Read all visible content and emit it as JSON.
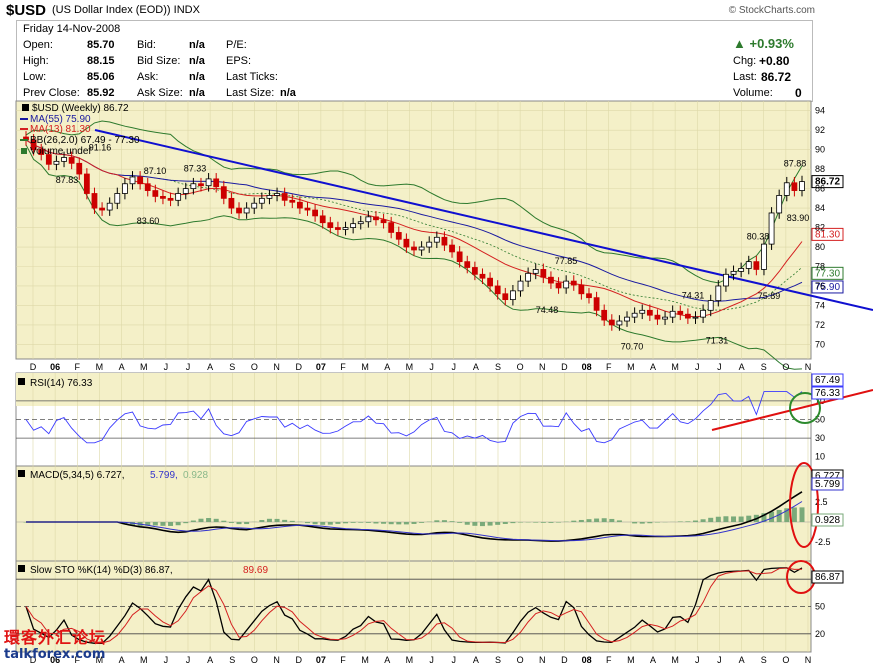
{
  "header": {
    "symbol": "$USD",
    "name": "(US Dollar Index (EOD))",
    "exchange": "INDX",
    "copyright": "© StockCharts.com"
  },
  "quote": {
    "date": "Friday  14-Nov-2008",
    "open_label": "Open:",
    "open": "85.70",
    "high_label": "High:",
    "high": "88.15",
    "low_label": "Low:",
    "low": "85.06",
    "prev_label": "Prev Close:",
    "prev": "85.92",
    "bid_label": "Bid:",
    "bid": "n/a",
    "bidsize_label": "Bid Size:",
    "bidsize": "n/a",
    "ask_label": "Ask:",
    "ask": "n/a",
    "asksize_label": "Ask Size:",
    "asksize": "n/a",
    "pe_label": "P/E:",
    "eps_label": "EPS:",
    "lastticks_label": "Last Ticks:",
    "lastsize_label": "Last Size:",
    "lastsize": "n/a",
    "pct_change": "+0.93%",
    "chg_label": "Chg:",
    "chg": "+0.80",
    "last_label": "Last:",
    "last": "86.72",
    "volume_label": "Volume:",
    "volume": "0"
  },
  "legend": {
    "main": "$USD (Weekly) 86.72",
    "ma55": "MA(55) 75.90",
    "ma13": "MA(13) 81.30",
    "bb": "BB(26,2.0) 67.49 - 77.30",
    "vol": "Volume undef",
    "rsi": "RSI(14) 76.33",
    "macd_a": "MACD(5,34,5) 6.727,",
    "macd_b": "5.799,",
    "macd_c": "0.928",
    "sto_a": "Slow STO %K(14) %D(3) 86.87,",
    "sto_b": "89.69"
  },
  "colors": {
    "panel_bg": "#f4f0c8",
    "rsi_bg": "#ffffff",
    "price_up": "#000000",
    "price_down": "#cc0000",
    "bb": "#2d7a2d",
    "ma55": "#1a1aa0",
    "ma13": "#d42020",
    "trend_main": "#1010d0",
    "annotation": "#e01010"
  },
  "watermark": {
    "line1": "環客外汇论坛",
    "line2": "talkforex.com"
  },
  "chart_data": [
    {
      "type": "candlestick",
      "title": "$USD (Weekly) 86.72",
      "x_ticks": [
        "D",
        "06",
        "F",
        "M",
        "A",
        "M",
        "J",
        "J",
        "A",
        "S",
        "O",
        "N",
        "D",
        "07",
        "F",
        "M",
        "A",
        "M",
        "J",
        "J",
        "A",
        "S",
        "O",
        "N",
        "D",
        "08",
        "F",
        "M",
        "A",
        "M",
        "J",
        "J",
        "A",
        "S",
        "O",
        "N"
      ],
      "y_ticks": [
        70,
        72,
        74,
        76,
        78,
        80,
        82,
        84,
        86,
        88,
        90,
        92,
        94
      ],
      "ylim": [
        68.5,
        95
      ],
      "close_series": [
        91,
        90,
        89.5,
        88.5,
        88.8,
        89.2,
        88.6,
        87.5,
        85.5,
        84,
        83.8,
        84.5,
        85.5,
        86.5,
        87.2,
        86.5,
        85.8,
        85.2,
        85,
        84.8,
        85.5,
        86,
        86.5,
        86.3,
        87,
        86.2,
        85,
        84,
        83.5,
        84,
        84.5,
        85,
        85.3,
        85.5,
        84.8,
        84.6,
        84,
        83.8,
        83.2,
        82.5,
        82,
        81.8,
        82,
        82.4,
        82.6,
        83.1,
        82.8,
        82.5,
        81.5,
        80.8,
        80,
        79.7,
        80,
        80.5,
        81,
        80.2,
        79.5,
        78.5,
        77.9,
        77.2,
        76.8,
        76,
        75.2,
        74.6,
        75.5,
        76.5,
        77.3,
        77.7,
        76.9,
        76.3,
        75.8,
        76.5,
        76.1,
        75.2,
        74.8,
        73.5,
        72.5,
        72,
        72.4,
        72.8,
        73.2,
        73.5,
        73,
        72.6,
        72.8,
        73.4,
        73.1,
        72.7,
        72.8,
        73.5,
        74.5,
        76,
        77.2,
        77.5,
        77.8,
        78.5,
        77.7,
        80.3,
        83.5,
        85.3,
        86.6,
        85.8,
        86.72
      ],
      "annotations": [
        {
          "label": "91.16",
          "value": 91.16
        },
        {
          "label": "87.83",
          "value": 87.83
        },
        {
          "label": "87.33",
          "value": 87.33
        },
        {
          "label": "83.60",
          "value": 83.6
        },
        {
          "label": "87.10",
          "value": 87.1
        },
        {
          "label": "77.85",
          "value": 77.85
        },
        {
          "label": "74.48",
          "value": 74.48
        },
        {
          "label": "74.31",
          "value": 74.31
        },
        {
          "label": "70.70",
          "value": 70.7
        },
        {
          "label": "71.31",
          "value": 71.31
        },
        {
          "label": "75.89",
          "value": 75.89
        },
        {
          "label": "80.38",
          "value": 80.38
        },
        {
          "label": "83.90",
          "value": 83.9
        },
        {
          "label": "87.88",
          "value": 87.88
        }
      ],
      "right_labels": [
        {
          "label": "86.72",
          "value": 86.72
        },
        {
          "label": "81.30",
          "value": 81.3
        },
        {
          "label": "77.30",
          "value": 77.3
        },
        {
          "label": "75.90",
          "value": 75.9
        }
      ]
    },
    {
      "type": "line",
      "title": "RSI(14) 76.33",
      "y_ticks": [
        10,
        30,
        50,
        70,
        90
      ],
      "ylim": [
        0,
        100
      ],
      "reference_lines": [
        30,
        50,
        70
      ],
      "right_labels": [
        {
          "label": "67.49"
        },
        {
          "label": "76.33"
        }
      ]
    },
    {
      "type": "line",
      "title": "MACD(5,34,5) 6.727, 5.799, 0.928",
      "y_ticks": [
        -2.5,
        2.5
      ],
      "right_labels": [
        {
          "label": "6.727"
        },
        {
          "label": "5.799"
        },
        {
          "label": "0.928"
        }
      ]
    },
    {
      "type": "line",
      "title": "Slow STO %K(14) %D(3) 86.87, 89.69",
      "y_ticks": [
        20,
        50,
        80
      ],
      "ylim": [
        0,
        100
      ],
      "reference_lines": [
        20,
        50,
        80
      ],
      "right_labels": [
        {
          "label": "86.87"
        }
      ]
    }
  ]
}
